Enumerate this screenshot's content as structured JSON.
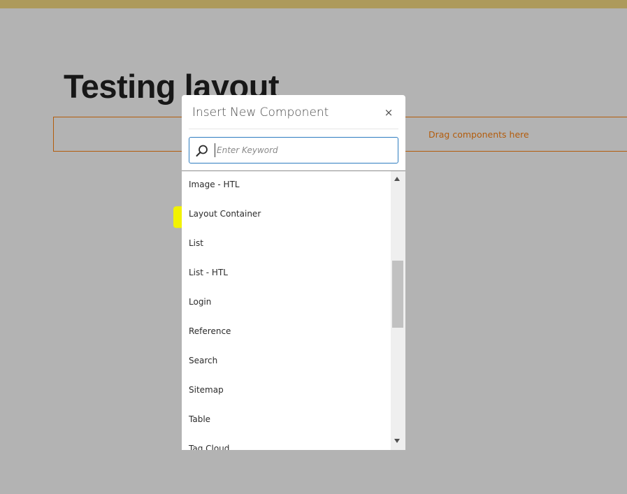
{
  "page": {
    "title": "Testing layout",
    "drop_zone_label": "Drag components here"
  },
  "dialog": {
    "title": "Insert New Component",
    "close_label": "×",
    "search": {
      "placeholder": "Enter Keyword",
      "value": ""
    },
    "items": [
      {
        "label": "Image - HTL"
      },
      {
        "label": "Layout Container",
        "highlighted": true
      },
      {
        "label": "List"
      },
      {
        "label": "List - HTL"
      },
      {
        "label": "Login"
      },
      {
        "label": "Reference"
      },
      {
        "label": "Search"
      },
      {
        "label": "Sitemap"
      },
      {
        "label": "Table"
      },
      {
        "label": "Tag Cloud"
      }
    ]
  },
  "colors": {
    "top_bar": "#ad9a5c",
    "background": "#b3b3b3",
    "drop_zone_accent": "#b35c0c",
    "search_border": "#2d7cc0",
    "highlight": "#f2f200"
  }
}
